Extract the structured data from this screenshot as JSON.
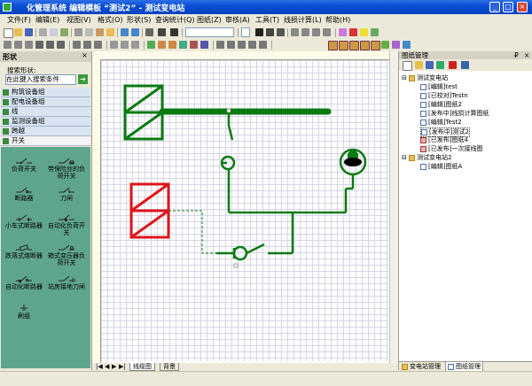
{
  "window": {
    "title": "化管理系统 编辑模板 “测试2” - 测试变电站",
    "min": "_",
    "max": "□",
    "close": "×"
  },
  "menu": [
    "文件(F)",
    "编辑(E)",
    "视图(V)",
    "格式(O)",
    "形状(S)",
    "查询统计(Q)",
    "图纸(Z)",
    "审核(A)",
    "工具(T)",
    "线损计算(L)",
    "帮助(H)"
  ],
  "left_panel": {
    "title": "形状",
    "search_label": "搜索形状:",
    "search_placeholder": "在此键入搜索条件",
    "categories": [
      "构筑设备组",
      "配电设备组",
      "线",
      "监测设备组",
      "跨越",
      "开关"
    ],
    "tools": [
      "负荷开关",
      "带保险丝的负荷开关",
      "断路器",
      "刀闸",
      "小车式断路器",
      "自动化负荷开关",
      "跌落式熔断器",
      "箱式变压器负荷开关",
      "自动化断路器",
      "站房接地刀闸",
      "刷组"
    ]
  },
  "canvas": {
    "sheet_tabs": [
      "线缆图",
      "背景"
    ],
    "colors": {
      "line": "#0a7a12",
      "selected": "#e0141a",
      "grid": "#d5d5e5"
    }
  },
  "right_panel": {
    "title": "图纸管理",
    "pin": "₽",
    "close": "×",
    "tree": [
      {
        "label": "测试变电站",
        "level": 0,
        "icon": "folder"
      },
      {
        "label": "[编辑]test",
        "level": 1,
        "icon": "doc"
      },
      {
        "label": "[已校对]Testn",
        "level": 1,
        "icon": "doc"
      },
      {
        "label": "[编辑]图纸2",
        "level": 1,
        "icon": "doc"
      },
      {
        "label": "[发布中]线损计算图纸",
        "level": 1,
        "icon": "doc"
      },
      {
        "label": "[编辑]Test2",
        "level": 1,
        "icon": "doc"
      },
      {
        "label": "[发布中]测试2",
        "level": 1,
        "icon": "doc",
        "selected": true
      },
      {
        "label": "[已发布]图纸4",
        "level": 1,
        "icon": "docred"
      },
      {
        "label": "[已发布]一次接线图",
        "level": 1,
        "icon": "docred"
      },
      {
        "label": "测试变电站2",
        "level": 0,
        "icon": "folder"
      },
      {
        "label": "[编辑]图纸A",
        "level": 1,
        "icon": "doc"
      }
    ],
    "bottom_tabs": [
      "变电站管理",
      "图纸管理"
    ]
  }
}
